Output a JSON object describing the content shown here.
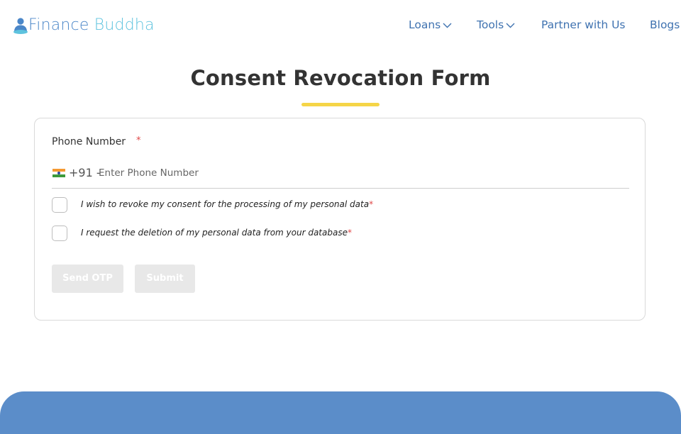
{
  "header": {
    "logo": {
      "word1": "Finance",
      "word2": "Buddha",
      "icon": "buddha-person-icon"
    },
    "nav": [
      {
        "label": "Loans",
        "has_dropdown": true
      },
      {
        "label": "Tools",
        "has_dropdown": true
      },
      {
        "label": "Partner with Us",
        "has_dropdown": false
      },
      {
        "label": "Blogs",
        "has_dropdown": false
      }
    ]
  },
  "page": {
    "title": "Consent Revocation Form"
  },
  "form": {
    "phone_label": "Phone Number",
    "required_marker": "*",
    "country_flag": "india-flag-icon",
    "dial_code": "+91 -",
    "phone_placeholder": "Enter Phone Number",
    "phone_value": "",
    "checkboxes": [
      {
        "label": "I wish to revoke my consent for the processing of my personal data",
        "required": "*",
        "checked": false
      },
      {
        "label": "I request the deletion of my personal data from your database",
        "required": "*",
        "checked": false
      }
    ],
    "send_otp_label": "Send OTP",
    "submit_label": "Submit"
  },
  "colors": {
    "nav_link": "#3f72b0",
    "logo_primary": "#4a86c8",
    "logo_secondary": "#5ec3de",
    "title_underline": "#f5d547",
    "required": "#e04848",
    "button_disabled": "#e8e8e8",
    "footer_band": "#5b8dc9"
  }
}
